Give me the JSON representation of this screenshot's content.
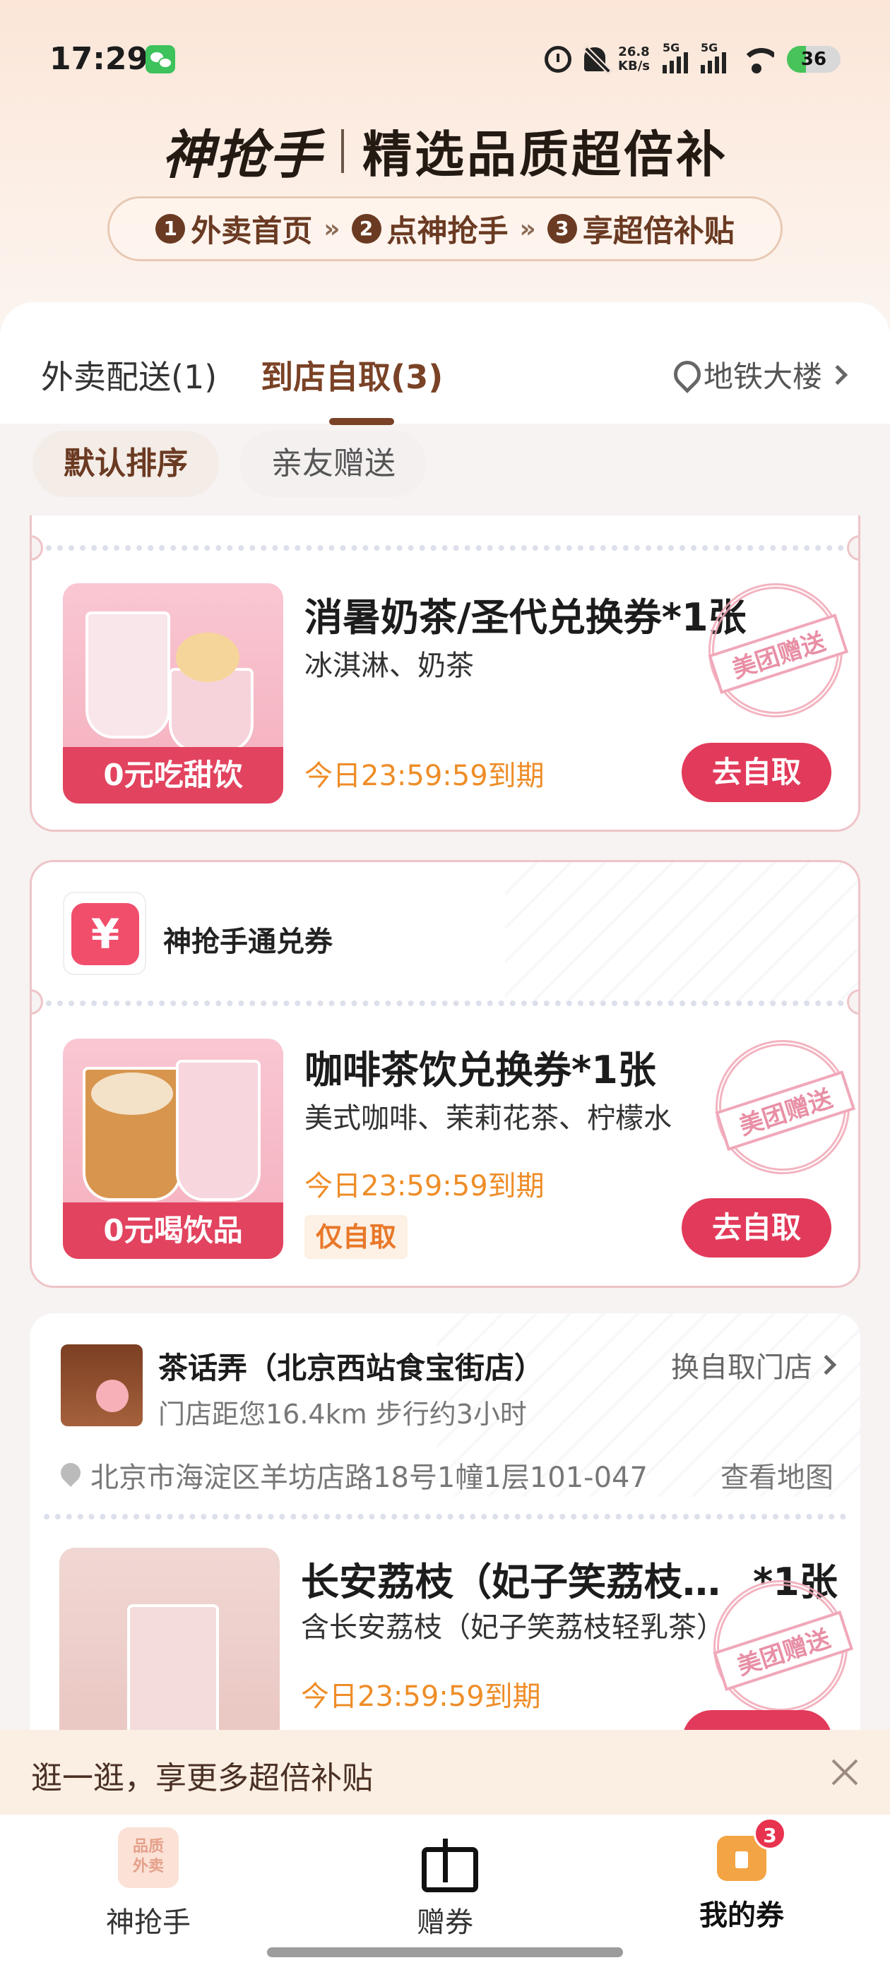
{
  "status_bar": {
    "time": "17:29",
    "speed_top": "26.8",
    "speed_unit": "KB/s",
    "network1": "5G",
    "network2": "5G",
    "battery": "36",
    "battery_level": 0.36
  },
  "hero": {
    "brand": "神抢手",
    "slogan": "精选品质超倍补",
    "steps": [
      {
        "num": "1",
        "label": "外卖首页"
      },
      {
        "num": "2",
        "label": "点神抢手"
      },
      {
        "num": "3",
        "label": "享超倍补贴"
      }
    ],
    "step_sep": "»"
  },
  "tabs": [
    {
      "label": "外卖配送(1)",
      "active": false
    },
    {
      "label": "到店自取(3)",
      "active": true
    }
  ],
  "location": "地铁大楼",
  "filters": [
    {
      "label": "默认排序",
      "active": true
    },
    {
      "label": "亲友赠送",
      "active": false
    }
  ],
  "coupons": [
    {
      "title": "消暑奶茶/圣代兑换券*1张",
      "subtitle": "冰淇淋、奶茶",
      "thumb_label": "0元吃甜饮",
      "expiry": "今日23:59:59到期",
      "button": "去自取",
      "stamp": "美团赠送"
    },
    {
      "header": "神抢手通兑券",
      "header_icon": "¥",
      "title": "咖啡茶饮兑换券*1张",
      "subtitle": "美式咖啡、茉莉花茶、柠檬水",
      "thumb_label": "0元喝饮品",
      "expiry": "今日23:59:59到期",
      "tag": "仅自取",
      "button": "去自取",
      "stamp": "美团赠送"
    }
  ],
  "store": {
    "name": "茶话弄（北京西站食宝街店）",
    "distance": "门店距您16.4km  步行约3小时",
    "change": "换自取门店",
    "address": "北京市海淀区羊坊店路18号1幢1层101-047",
    "map": "查看地图",
    "item": {
      "title": "长安荔枝（妃子笑荔枝…",
      "qty": "*1张",
      "subtitle": "含长安荔枝（妃子笑荔枝轻乳茶）",
      "expiry": "今日23:59:59到期",
      "stamp": "美团赠送"
    }
  },
  "promo": {
    "text": "逛一逛，享更多超倍补贴"
  },
  "bottom_nav": [
    {
      "label": "神抢手",
      "icon": "shenqiangshou-icon"
    },
    {
      "label": "赠券",
      "icon": "gift-icon"
    },
    {
      "label": "我的券",
      "icon": "coupon-icon",
      "badge": "3"
    }
  ]
}
